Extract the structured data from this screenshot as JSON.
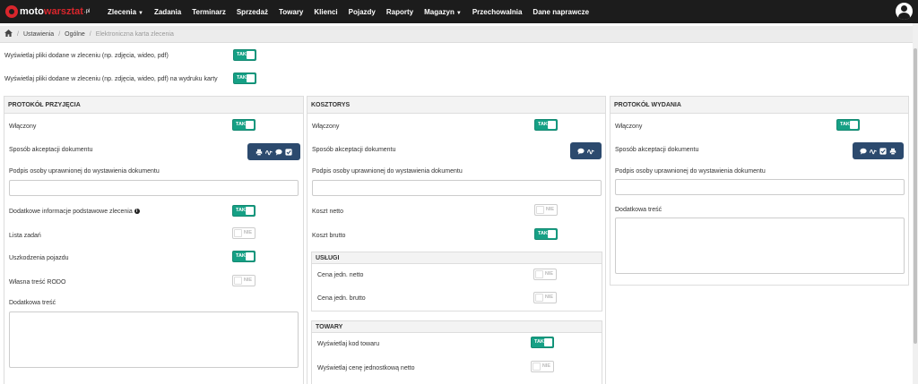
{
  "app": {
    "logo_part1": "moto",
    "logo_part2": "warsztat",
    "logo_part3": ".pl"
  },
  "nav": {
    "items": [
      {
        "label": "Zlecenia",
        "caret": true
      },
      {
        "label": "Zadania",
        "caret": false
      },
      {
        "label": "Terminarz",
        "caret": false
      },
      {
        "label": "Sprzedaż",
        "caret": false
      },
      {
        "label": "Towary",
        "caret": false
      },
      {
        "label": "Klienci",
        "caret": false
      },
      {
        "label": "Pojazdy",
        "caret": false
      },
      {
        "label": "Raporty",
        "caret": false
      },
      {
        "label": "Magazyn",
        "caret": true
      },
      {
        "label": "Przechowalnia",
        "caret": false
      },
      {
        "label": "Dane naprawcze",
        "caret": false
      }
    ]
  },
  "breadcrumb": {
    "items": [
      "Ustawienia",
      "Ogólne",
      "Elektroniczna karta zlecenia"
    ],
    "separator": "/"
  },
  "toggles": {
    "on_label": "TAK",
    "off_label": "NIE"
  },
  "top": {
    "row1_label": "Wyświetlaj pliki dodane w zleceniu (np. zdjęcia, wideo, pdf)",
    "row1_value": "on",
    "row2_label": "Wyświetlaj pliki dodane w zleceniu (np. zdjęcia, wideo, pdf) na wydruku karty",
    "row2_value": "on"
  },
  "panel_przyjecia": {
    "title": "PROTOKÓŁ PRZYJĘCIA",
    "wlaczony_label": "Włączony",
    "wlaczony_value": "on",
    "sposob_label": "Sposób akceptacji dokumentu",
    "sposob_icons": [
      "printer-icon",
      "signature-icon",
      "comment-icon",
      "check-square-icon"
    ],
    "podpis_label": "Podpis osoby uprawnionej do wystawienia dokumentu",
    "podpis_value": "",
    "dodatkowe_info_label": "Dodatkowe informacje podstawowe zlecenia",
    "dodatkowe_info_value": "on",
    "lista_zadan_label": "Lista zadań",
    "lista_zadan_value": "off",
    "uszkodzenia_label": "Uszkodzenia pojazdu",
    "uszkodzenia_value": "on",
    "rodo_label": "Własna treść RODO",
    "rodo_value": "off",
    "dodatkowa_tresc_label": "Dodatkowa treść",
    "dodatkowa_tresc_value": ""
  },
  "panel_kosztorys": {
    "title": "KOSZTORYS",
    "wlaczony_label": "Włączony",
    "wlaczony_value": "on",
    "sposob_label": "Sposób akceptacji dokumentu",
    "sposob_icons": [
      "comment-icon",
      "signature-icon"
    ],
    "podpis_label": "Podpis osoby uprawnionej do wystawienia dokumentu",
    "podpis_value": "",
    "koszt_netto_label": "Koszt netto",
    "koszt_netto_value": "off",
    "koszt_brutto_label": "Koszt brutto",
    "koszt_brutto_value": "on",
    "uslugi": {
      "title": "USŁUGI",
      "cena_netto_label": "Cena jedn. netto",
      "cena_netto_value": "off",
      "cena_brutto_label": "Cena jedn. brutto",
      "cena_brutto_value": "off"
    },
    "towary": {
      "title": "TOWARY",
      "kod_label": "Wyświetlaj kod towaru",
      "kod_value": "on",
      "cena_netto_label": "Wyświetlaj cenę jednostkową netto",
      "cena_netto_value": "off"
    }
  },
  "panel_wydania": {
    "title": "PROTOKÓŁ WYDANIA",
    "wlaczony_label": "Włączony",
    "wlaczony_value": "on",
    "sposob_label": "Sposób akceptacji dokumentu",
    "sposob_icons": [
      "comment-icon",
      "signature-icon",
      "check-square-icon",
      "printer-icon"
    ],
    "podpis_label": "Podpis osoby uprawnionej do wystawienia dokumentu",
    "podpis_value": "",
    "dodatkowa_tresc_label": "Dodatkowa treść",
    "dodatkowa_tresc_value": ""
  },
  "colors": {
    "navbar": "#1c1c1c",
    "brand_red": "#d9262c",
    "toggle_on": "#16a085",
    "accept_button": "#2c4a6e"
  }
}
